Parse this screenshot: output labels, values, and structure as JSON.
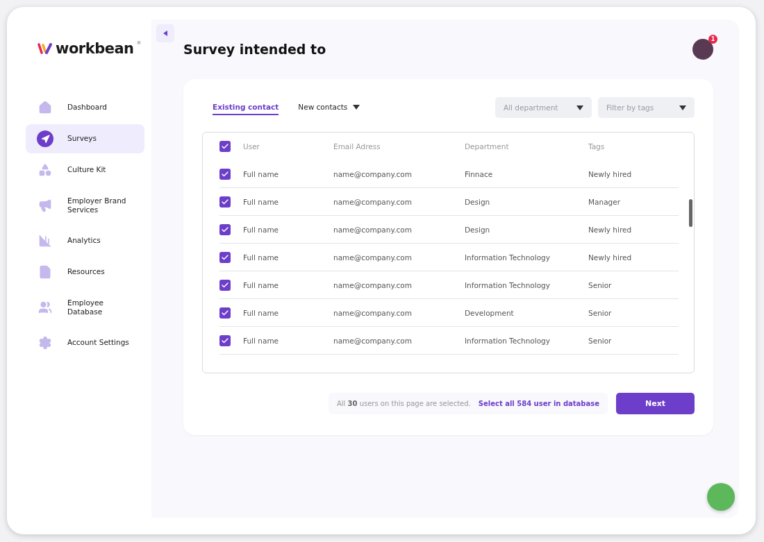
{
  "brand": {
    "name": "workbean",
    "mark": "®"
  },
  "sidebar": {
    "items": [
      {
        "label": "Dashboard",
        "selected": false
      },
      {
        "label": "Surveys",
        "selected": true
      },
      {
        "label": "Culture Kit",
        "selected": false
      },
      {
        "label": "Employer Brand Services",
        "selected": false
      },
      {
        "label": "Analytics",
        "selected": false
      },
      {
        "label": "Resources",
        "selected": false
      },
      {
        "label": "Employee Database",
        "selected": false
      },
      {
        "label": "Account Settings",
        "selected": false
      }
    ]
  },
  "header": {
    "title": "Survey intended to",
    "notification_count": "1"
  },
  "tabs": [
    {
      "label": "Existing contact",
      "selected": true,
      "dropdown": false
    },
    {
      "label": "New contacts",
      "selected": false,
      "dropdown": true
    }
  ],
  "filters": [
    {
      "placeholder": "All department"
    },
    {
      "placeholder": "Filter by tags"
    }
  ],
  "table": {
    "all_checked": true,
    "columns": [
      "User",
      "Email Adress",
      "Department",
      "Tags"
    ],
    "rows": [
      {
        "checked": true,
        "cells": [
          "Full name",
          "name@company.com",
          "Finnace",
          "Newly hired"
        ]
      },
      {
        "checked": true,
        "cells": [
          "Full name",
          "name@company.com",
          "Design",
          "Manager"
        ]
      },
      {
        "checked": true,
        "cells": [
          "Full name",
          "name@company.com",
          "Design",
          "Newly hired"
        ]
      },
      {
        "checked": true,
        "cells": [
          "Full name",
          "name@company.com",
          "Information Technology",
          "Newly hired"
        ]
      },
      {
        "checked": true,
        "cells": [
          "Full name",
          "name@company.com",
          "Information Technology",
          "Senior"
        ]
      },
      {
        "checked": true,
        "cells": [
          "Full name",
          "name@company.com",
          "Development",
          "Senior"
        ]
      },
      {
        "checked": true,
        "cells": [
          "Full name",
          "name@company.com",
          "Information Technology",
          "Senior"
        ]
      }
    ]
  },
  "footer": {
    "selection_note": "All **30** users on this page are selected.",
    "select_all_link": "Select all 584 user in database",
    "next_button": "Next"
  }
}
